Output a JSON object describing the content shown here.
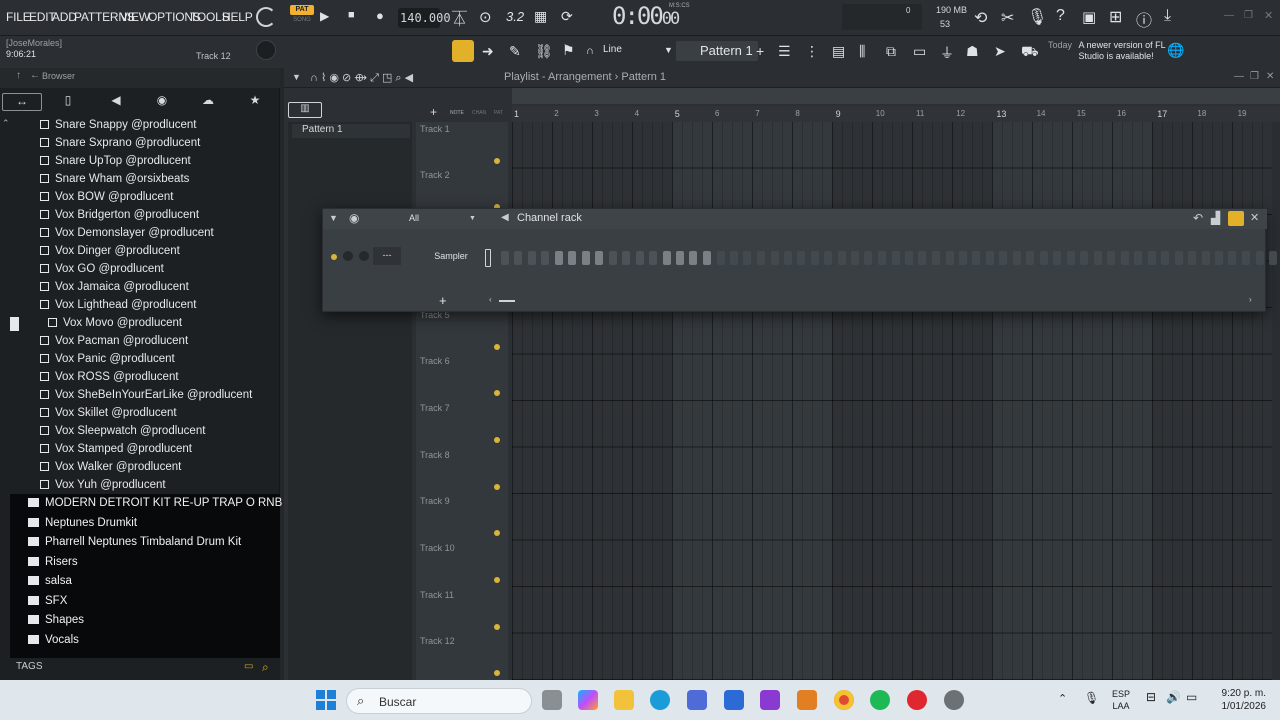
{
  "menu": [
    "FILE",
    "EDIT",
    "ADD",
    "PATTERNS",
    "VIEW",
    "OPTIONS",
    "TOOLS",
    "HELP"
  ],
  "transport": {
    "pat_label": "PAT",
    "song_label": "SONG",
    "tempo": "140.000",
    "time": "0:00",
    "time_sub": "00",
    "time_format": "M:S:CS",
    "beat_label": "3.2"
  },
  "memory": {
    "ram": "190 MB",
    "cpu": "53",
    "cpu_zero": "0"
  },
  "user": {
    "name": "[JoseMorales]",
    "time": "9:06:21"
  },
  "track_hint": "Track 12",
  "toolbar2": {
    "snap": "Line",
    "pattern": "Pattern 1",
    "today": "Today",
    "news": "A newer version of FL Studio is available!"
  },
  "browser": {
    "title": "Browser",
    "files": [
      "Snare Snappy @prodlucent",
      "Snare Sxprano @prodlucent",
      "Snare UpTop @prodlucent",
      "Snare Wham @orsixbeats",
      "Vox BOW @prodlucent",
      "Vox Bridgerton @prodlucent",
      "Vox Demonslayer @prodlucent",
      "Vox Dinger @prodlucent",
      "Vox GO @prodlucent",
      "Vox Jamaica @prodlucent",
      "Vox Lighthead @prodlucent",
      "Vox Movo @prodlucent",
      "Vox Pacman @prodlucent",
      "Vox Panic @prodlucent",
      "Vox ROSS @prodlucent",
      "Vox SheBeInYourEarLike @prodlucent",
      "Vox Skillet @prodlucent",
      "Vox Sleepwatch @prodlucent",
      "Vox Stamped @prodlucent",
      "Vox Walker @prodlucent",
      "Vox Yuh @prodlucent"
    ],
    "folders": [
      "MODERN DETROIT KIT RE-UP TRAP O RNB",
      "Neptunes Drumkit",
      "Pharrell Neptunes Timbaland Drum Kit",
      "Risers",
      "salsa",
      "SFX",
      "Shapes",
      "Vocals"
    ],
    "tags": "TAGS"
  },
  "playlist": {
    "title": "Playlist - Arrangement",
    "pattern": "Pattern 1",
    "pattern_item": "Pattern 1",
    "ruler": [
      "1",
      "2",
      "3",
      "4",
      "5",
      "6",
      "7",
      "8",
      "9",
      "10",
      "11",
      "12",
      "13",
      "14",
      "15",
      "16",
      "17",
      "18",
      "19"
    ],
    "tracks": [
      "Track 1",
      "Track 2",
      "Track 5",
      "Track 6",
      "Track 7",
      "Track 8",
      "Track 9",
      "Track 10",
      "Track 11",
      "Track 12"
    ],
    "track_header_labels": [
      "NOTE",
      "CHAN",
      "PAT"
    ]
  },
  "channel_rack": {
    "title": "Channel rack",
    "filter": "All",
    "channel_name": "Sampler",
    "mixer_slot": "---",
    "steps_on": [
      4,
      5,
      6,
      7,
      12,
      13,
      14,
      15
    ]
  },
  "taskbar": {
    "search": "Buscar",
    "lang_top": "ESP",
    "lang_bottom": "LAA",
    "time": "9:20 p. m.",
    "date": "1/01/2026"
  },
  "colors": {
    "accent": "#e2b129",
    "background": "#23272a",
    "taskbar": "#dfe6ec"
  }
}
